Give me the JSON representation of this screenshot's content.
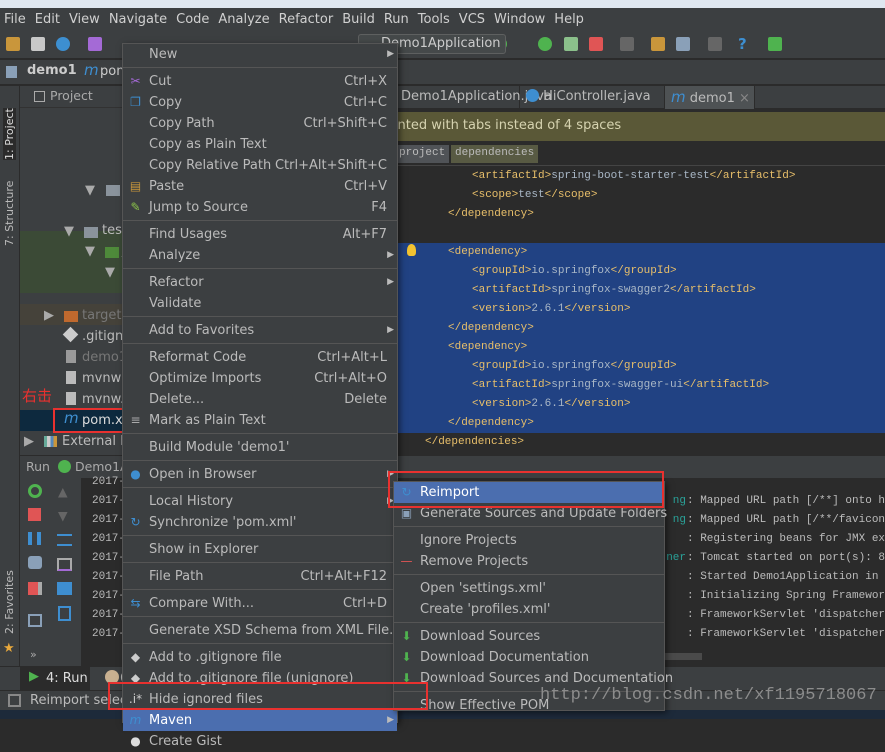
{
  "menubar": [
    "File",
    "Edit",
    "View",
    "Navigate",
    "Code",
    "Analyze",
    "Refactor",
    "Build",
    "Run",
    "Tools",
    "VCS",
    "Window",
    "Help"
  ],
  "toolbar": {
    "run_config": "Demo1Application"
  },
  "breadcrumb": {
    "project": "demo1",
    "file": "pom.xml"
  },
  "left_strip": {
    "project": "1: Project",
    "structure": "7: Structure",
    "favorites": "2: Favorites"
  },
  "project_panel": {
    "title": "Project",
    "items": [
      {
        "label": "test"
      },
      {
        "label": "j"
      },
      {
        "label": "target"
      },
      {
        "label": ".gitignore"
      },
      {
        "label": "demo1.iml"
      },
      {
        "label": "mvnw"
      },
      {
        "label": "mvnw.cmd"
      },
      {
        "label": "pom.xml"
      },
      {
        "label": "External Libraries"
      }
    ],
    "annotation": "右击"
  },
  "editor": {
    "tabs": [
      {
        "label": "Demo1Application.java"
      },
      {
        "label": "HiController.java"
      },
      {
        "label": "demo1"
      }
    ],
    "notice": "File is indented with tabs instead of 4 spaces",
    "xml_breadcrumb": [
      "project",
      "dependencies"
    ],
    "code_lines": [
      {
        "open": "<artifactId>",
        "text": "spring-boot-starter-test",
        "close": "</artifactId>"
      },
      {
        "open": "<scope>",
        "text": "test",
        "close": "</scope>"
      },
      {
        "open": "</dependency>",
        "text": "",
        "close": ""
      },
      {
        "open": "",
        "text": "",
        "close": ""
      },
      {
        "open": "<dependency>",
        "text": "",
        "close": ""
      },
      {
        "open": "<groupId>",
        "text": "io.springfox",
        "close": "</groupId>"
      },
      {
        "open": "<artifactId>",
        "text": "springfox-swagger2",
        "close": "</artifactId>"
      },
      {
        "open": "<version>",
        "text": "2.6.1",
        "close": "</version>"
      },
      {
        "open": "</dependency>",
        "text": "",
        "close": ""
      },
      {
        "open": "<dependency>",
        "text": "",
        "close": ""
      },
      {
        "open": "<groupId>",
        "text": "io.springfox",
        "close": "</groupId>"
      },
      {
        "open": "<artifactId>",
        "text": "springfox-swagger-ui",
        "close": "</artifactId>"
      },
      {
        "open": "<version>",
        "text": "2.6.1",
        "close": "</version>"
      },
      {
        "open": "</dependency>",
        "text": "",
        "close": ""
      },
      {
        "open": "</dependencies>",
        "text": "",
        "close": ""
      }
    ]
  },
  "run_panel": {
    "title": "Run",
    "config": "Demo1Application",
    "log": [
      {
        "date": "2017-",
        "logger": "",
        "msg": ""
      },
      {
        "date": "2017-",
        "logger": "ng",
        "msg": ": Mapped URL path [/**] onto hand"
      },
      {
        "date": "2017-",
        "logger": "ng",
        "msg": ": Mapped URL path [/**/favicon.ic"
      },
      {
        "date": "2017-",
        "logger": "",
        "msg": ": Registering beans for JMX expos"
      },
      {
        "date": "2017-",
        "logger": "ner",
        "msg": ": Tomcat started on port(s): 8080"
      },
      {
        "date": "2017-",
        "logger": "",
        "msg": ": Started Demo1Application in 4.5"
      },
      {
        "date": "2017-",
        "logger": "",
        "msg": ": Initializing Spring FrameworkSe"
      },
      {
        "date": "2017-",
        "logger": "",
        "msg": ": FrameworkServlet 'dispatcherSer"
      },
      {
        "date": "2017-",
        "logger": "",
        "msg": ": FrameworkServlet 'dispatcherSer"
      }
    ]
  },
  "bottom_tabs": {
    "run": "4: Run",
    "other": "6"
  },
  "status": "Reimport selected Maven projects",
  "context_menu": [
    {
      "label": "New",
      "submenu": true
    },
    {
      "sep": true
    },
    {
      "label": "Cut",
      "shortcut": "Ctrl+X",
      "icon": "scissors-icon"
    },
    {
      "label": "Copy",
      "shortcut": "Ctrl+C",
      "icon": "copy-icon"
    },
    {
      "label": "Copy Path",
      "shortcut": "Ctrl+Shift+C"
    },
    {
      "label": "Copy as Plain Text"
    },
    {
      "label": "Copy Relative Path",
      "shortcut": "Ctrl+Alt+Shift+C"
    },
    {
      "label": "Paste",
      "shortcut": "Ctrl+V",
      "icon": "paste-icon"
    },
    {
      "label": "Jump to Source",
      "shortcut": "F4",
      "icon": "edit-source-icon"
    },
    {
      "sep": true
    },
    {
      "label": "Find Usages",
      "shortcut": "Alt+F7"
    },
    {
      "label": "Analyze",
      "submenu": true
    },
    {
      "sep": true
    },
    {
      "label": "Refactor",
      "submenu": true
    },
    {
      "label": "Validate"
    },
    {
      "sep": true
    },
    {
      "label": "Add to Favorites",
      "submenu": true
    },
    {
      "sep": true
    },
    {
      "label": "Reformat Code",
      "shortcut": "Ctrl+Alt+L"
    },
    {
      "label": "Optimize Imports",
      "shortcut": "Ctrl+Alt+O"
    },
    {
      "label": "Delete...",
      "shortcut": "Delete"
    },
    {
      "label": "Mark as Plain Text",
      "icon": "plain-text-icon"
    },
    {
      "sep": true
    },
    {
      "label": "Build Module 'demo1'"
    },
    {
      "sep": true
    },
    {
      "label": "Open in Browser",
      "submenu": true,
      "icon": "globe-icon"
    },
    {
      "sep": true
    },
    {
      "label": "Local History",
      "submenu": true
    },
    {
      "label": "Synchronize 'pom.xml'",
      "icon": "sync-icon"
    },
    {
      "sep": true
    },
    {
      "label": "Show in Explorer"
    },
    {
      "sep": true
    },
    {
      "label": "File Path",
      "shortcut": "Ctrl+Alt+F12"
    },
    {
      "sep": true
    },
    {
      "label": "Compare With...",
      "shortcut": "Ctrl+D",
      "icon": "compare-icon"
    },
    {
      "sep": true
    },
    {
      "label": "Generate XSD Schema from XML File..."
    },
    {
      "sep": true
    },
    {
      "label": "Add to .gitignore file",
      "icon": "git-icon"
    },
    {
      "label": "Add to .gitignore file (unignore)",
      "icon": "git-icon"
    },
    {
      "label": "Hide ignored files",
      "icon": "ignored-icon"
    },
    {
      "label": "Maven",
      "submenu": true,
      "selected": true,
      "icon": "maven-icon"
    },
    {
      "label": "Create Gist",
      "icon": "github-icon"
    }
  ],
  "maven_submenu": [
    {
      "label": "Reimport",
      "selected": true,
      "icon": "sync-icon"
    },
    {
      "label": "Generate Sources and Update Folders",
      "icon": "generate-sources-icon"
    },
    {
      "sep": true
    },
    {
      "label": "Ignore Projects"
    },
    {
      "label": "Remove Projects",
      "icon": "minus-icon"
    },
    {
      "sep": true
    },
    {
      "label": "Open 'settings.xml'"
    },
    {
      "label": "Create 'profiles.xml'"
    },
    {
      "sep": true
    },
    {
      "label": "Download Sources",
      "icon": "download-icon"
    },
    {
      "label": "Download Documentation",
      "icon": "download-icon"
    },
    {
      "label": "Download Sources and Documentation",
      "icon": "download-icon"
    },
    {
      "sep": true
    },
    {
      "label": "Show Effective POM"
    }
  ],
  "watermark": "http://blog.csdn.net/xf1195718067",
  "colors": {
    "selection": "#214283",
    "menu_highlight": "#4b6eaf",
    "annotation_red": "#e8312f",
    "xml_tag": "#e8bf6a"
  }
}
